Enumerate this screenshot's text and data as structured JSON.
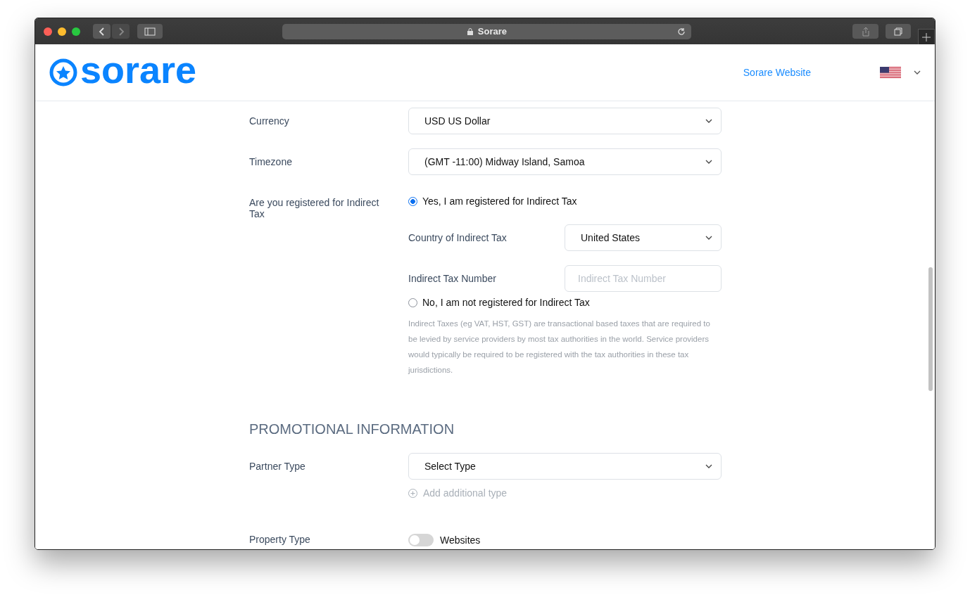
{
  "window": {
    "title": "Sorare"
  },
  "header": {
    "logo": "sorare",
    "link": "Sorare Website"
  },
  "fields": [
    {
      "kind": "select",
      "label": "Currency",
      "value": "USD US Dollar"
    },
    {
      "kind": "select",
      "label": "Timezone",
      "value": "(GMT -11:00) Midway Island, Samoa"
    },
    {
      "kind": "radio",
      "label": "Are you registered for Indirect Tax",
      "options": [
        {
          "label": "Yes, I am registered for Indirect Tax",
          "selected": true,
          "subfields": [
            {
              "kind": "select",
              "label": "Country of Indirect Tax",
              "value": "United States"
            },
            {
              "kind": "input",
              "label": "Indirect Tax Number",
              "placeholder": "Indirect Tax Number"
            }
          ]
        },
        {
          "label": "No, I am not registered for Indirect Tax",
          "selected": false
        }
      ],
      "help": "Indirect Taxes (eg VAT, HST, GST) are transactional based taxes that are required to be levied by service providers by most tax authorities in the world. Service providers would typically be required to be registered with the tax authorities in these tax jurisdictions."
    }
  ],
  "promotional": {
    "heading": "PROMOTIONAL INFORMATION",
    "fields": [
      {
        "kind": "select",
        "label": "Partner Type",
        "value": "Select Type",
        "add_link": {
          "label": "Add additional type",
          "disabled": true
        }
      },
      {
        "kind": "toggle",
        "label": "Property Type",
        "toggle_label": "Websites",
        "on": false
      }
    ]
  }
}
